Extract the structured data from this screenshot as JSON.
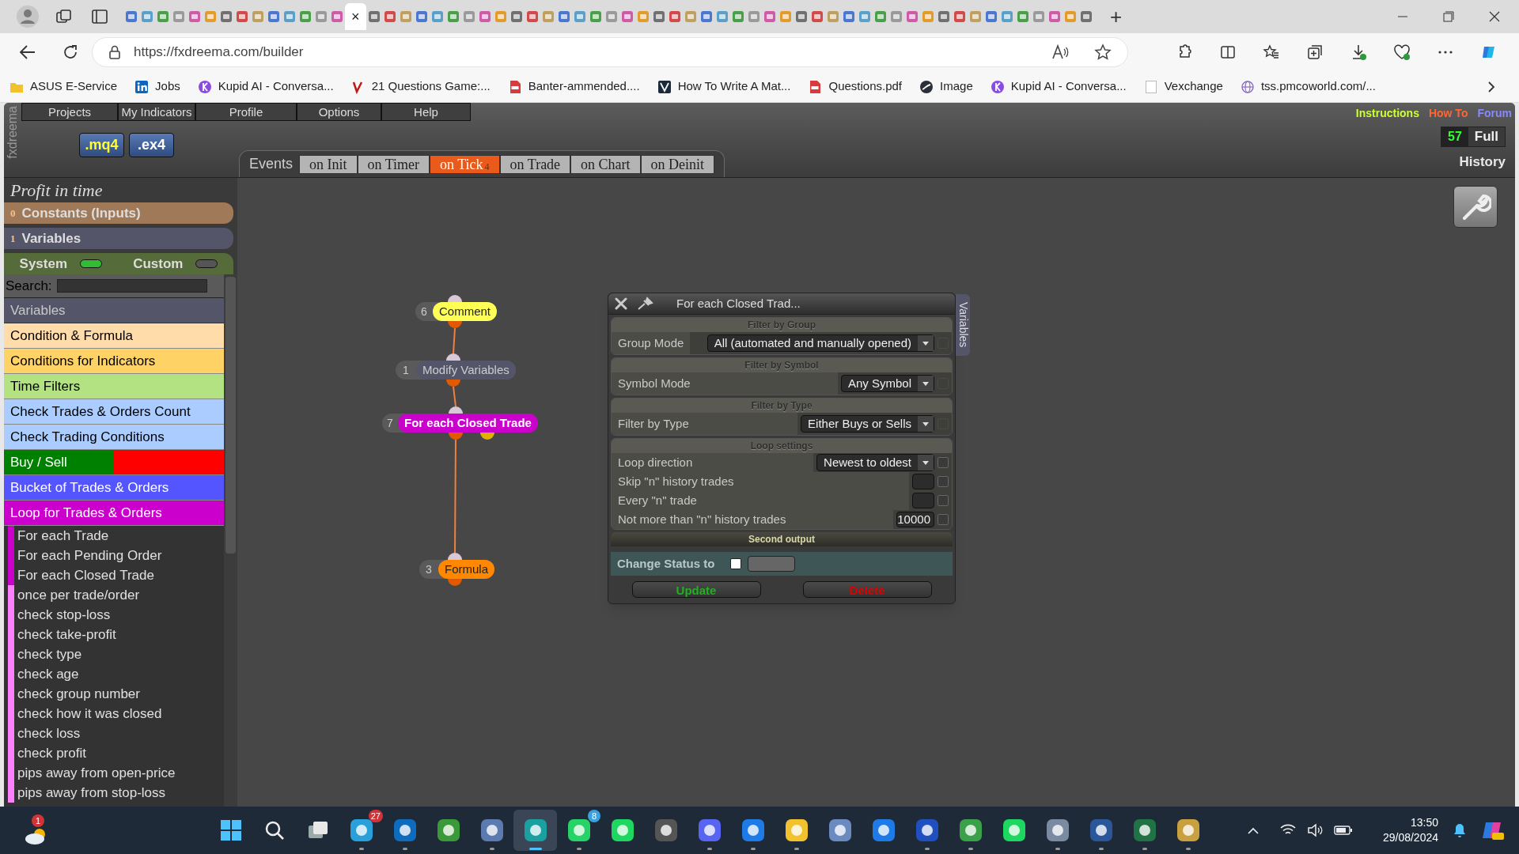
{
  "browser": {
    "tabs": [
      {
        "selected": false
      },
      {
        "selected": false
      },
      {
        "selected": false
      },
      {
        "selected": false
      },
      {
        "selected": false
      },
      {
        "selected": false
      },
      {
        "selected": false
      },
      {
        "selected": false
      },
      {
        "selected": false
      },
      {
        "selected": false
      },
      {
        "selected": false
      },
      {
        "selected": false
      },
      {
        "selected": false
      },
      {
        "selected": false
      },
      {
        "selected": true,
        "close": "×"
      },
      {
        "selected": false
      },
      {
        "selected": false
      },
      {
        "selected": false
      },
      {
        "selected": false
      },
      {
        "selected": false
      },
      {
        "selected": false
      },
      {
        "selected": false
      },
      {
        "selected": false
      },
      {
        "selected": false
      },
      {
        "selected": false
      },
      {
        "selected": false
      },
      {
        "selected": false
      },
      {
        "selected": false
      },
      {
        "selected": false
      },
      {
        "selected": false
      },
      {
        "selected": false
      },
      {
        "selected": false
      },
      {
        "selected": false
      },
      {
        "selected": false
      },
      {
        "selected": false
      },
      {
        "selected": false
      },
      {
        "selected": false
      },
      {
        "selected": false
      },
      {
        "selected": false
      },
      {
        "selected": false
      },
      {
        "selected": false
      },
      {
        "selected": false
      },
      {
        "selected": false
      },
      {
        "selected": false
      },
      {
        "selected": false
      },
      {
        "selected": false
      },
      {
        "selected": false
      },
      {
        "selected": false
      },
      {
        "selected": false
      },
      {
        "selected": false
      },
      {
        "selected": false
      },
      {
        "selected": false
      },
      {
        "selected": false
      },
      {
        "selected": false
      },
      {
        "selected": false
      },
      {
        "selected": false
      },
      {
        "selected": false
      },
      {
        "selected": false
      },
      {
        "selected": false
      },
      {
        "selected": false
      },
      {
        "selected": false
      }
    ],
    "new_tab": "+",
    "address": "https://fxdreema.com/builder",
    "bookmarks": [
      {
        "kind": "folder",
        "label": "ASUS E-Service"
      },
      {
        "kind": "linkedin",
        "label": "Jobs"
      },
      {
        "kind": "k",
        "label": "Kupid AI - Conversa..."
      },
      {
        "kind": "red",
        "label": "21 Questions Game:..."
      },
      {
        "kind": "pdf",
        "label": "Banter-ammended...."
      },
      {
        "kind": "dark",
        "label": "How To Write A Mat..."
      },
      {
        "kind": "pdf",
        "label": "Questions.pdf"
      },
      {
        "kind": "circle",
        "label": "Image"
      },
      {
        "kind": "k",
        "label": "Kupid AI - Conversa..."
      },
      {
        "kind": "blank",
        "label": "Vexchange"
      },
      {
        "kind": "globe",
        "label": "tss.pmcoworld.com/..."
      }
    ]
  },
  "app": {
    "logo": "fxdreema",
    "menu": [
      "Projects",
      "My Indicators",
      "Profile",
      "Options",
      "Help"
    ],
    "file_buttons": [
      ".mq4",
      ".ex4"
    ],
    "events_label": "Events",
    "event_tabs": [
      {
        "label": "on Init",
        "selected": false
      },
      {
        "label": "on Timer",
        "selected": false
      },
      {
        "label": "on Tick",
        "selected": true,
        "count": "4"
      },
      {
        "label": "on Trade",
        "selected": false
      },
      {
        "label": "on Chart",
        "selected": false
      },
      {
        "label": "on Deinit",
        "selected": false
      }
    ],
    "links": [
      {
        "label": "Instructions",
        "color": "#ccff33"
      },
      {
        "label": "How To",
        "color": "#ff6633"
      },
      {
        "label": "Forum",
        "color": "#8888ff"
      }
    ],
    "counter": "57",
    "full": "Full",
    "history": "History"
  },
  "sidebar": {
    "project": "Profit in time",
    "sections": [
      {
        "count": "0",
        "label": "Constants (Inputs)",
        "color": "#a07a58"
      },
      {
        "count": "1",
        "label": "Variables",
        "color": "#55556a"
      }
    ],
    "toggles": [
      {
        "label": "System",
        "on": true
      },
      {
        "label": "Custom",
        "on": false
      }
    ],
    "search_label": "Search:",
    "list_title": "Variables",
    "categories": [
      {
        "label": "Condition & Formula",
        "color": "#ffdcaa"
      },
      {
        "label": "Conditions for Indicators",
        "color": "#ffd266"
      },
      {
        "label": "Time Filters",
        "color": "#b2e282"
      },
      {
        "label": "Check Trades & Orders Count",
        "color": "#aaccff"
      },
      {
        "label": "Check Trading Conditions",
        "color": "#aaccff"
      },
      {
        "label": "Buy / Sell",
        "segments": [
          {
            "color": "#008000"
          },
          {
            "color": "#ff0000"
          }
        ]
      },
      {
        "label": "Bucket of Trades & Orders",
        "color": "#5555ff"
      },
      {
        "label": "Loop for Trades & Orders",
        "color": "#cc00cc",
        "expanded": true,
        "children": [
          {
            "label": "For each Trade",
            "color": "#cc00cc"
          },
          {
            "label": "For each Pending Order",
            "color": "#cc00cc"
          },
          {
            "label": "For each Closed Trade",
            "color": "#cc00cc"
          },
          {
            "label": "once per trade/order",
            "color": "#ff80ff"
          },
          {
            "label": "check stop-loss",
            "color": "#ff80ff"
          },
          {
            "label": "check take-profit",
            "color": "#ff80ff"
          },
          {
            "label": "check type",
            "color": "#ff80ff"
          },
          {
            "label": "check age",
            "color": "#ff80ff"
          },
          {
            "label": "check group number",
            "color": "#ff80ff"
          },
          {
            "label": "check how it was closed",
            "color": "#ff80ff"
          },
          {
            "label": "check loss",
            "color": "#ff80ff"
          },
          {
            "label": "check profit",
            "color": "#ff80ff"
          },
          {
            "label": "pips away from open-price",
            "color": "#ff80ff"
          },
          {
            "label": "pips away from stop-loss",
            "color": "#ff80ff"
          }
        ]
      }
    ]
  },
  "canvas": {
    "nodes": [
      {
        "number": "6",
        "label": "Comment",
        "color": "#ffff55"
      },
      {
        "number": "1",
        "label": "Modify Variables",
        "color": "#55556a"
      },
      {
        "number": "7",
        "label": "For each Closed Trade",
        "color": "#cc00cc"
      },
      {
        "number": "3",
        "label": "Formula",
        "color": "#ff8800"
      }
    ]
  },
  "dialog": {
    "title": "For each Closed Trad...",
    "side_tab": "Variables",
    "sections": [
      {
        "heading": "Filter by Group",
        "rows": [
          {
            "label": "Group Mode",
            "kind": "select",
            "value": "All (automated and manually opened)",
            "checked": false
          }
        ]
      },
      {
        "heading": "Filter by Symbol",
        "rows": [
          {
            "label": "Symbol Mode",
            "kind": "select",
            "value": "Any Symbol",
            "checked": false
          }
        ]
      },
      {
        "heading": "Filter by Type",
        "rows": [
          {
            "label": "Filter by Type",
            "kind": "select",
            "value": "Either Buys or Sells",
            "checked": false
          }
        ]
      },
      {
        "heading": "Loop settings",
        "rows": [
          {
            "label": "Loop direction",
            "kind": "select",
            "value": "Newest to oldest",
            "checked": false
          },
          {
            "label": "Skip \"n\" history trades",
            "kind": "input",
            "checked": false
          },
          {
            "label": "Every \"n\" trade",
            "kind": "input",
            "checked": false
          },
          {
            "label": "Not more than \"n\" history trades",
            "kind": "input",
            "value": "10000",
            "checked": false
          }
        ]
      }
    ],
    "second_output": "Second output",
    "change_status": {
      "label": "Change Status to",
      "checked": false
    },
    "buttons": [
      {
        "label": "Update",
        "kind": "confirm"
      },
      {
        "label": "Delete",
        "kind": "danger"
      }
    ]
  },
  "taskbar": {
    "weather_badge": "1",
    "apps": [
      {
        "kind": "start",
        "open": false,
        "selected": false
      },
      {
        "kind": "search",
        "open": false,
        "selected": false
      },
      {
        "kind": "taskview",
        "open": false,
        "selected": false
      },
      {
        "kind": "app",
        "color": "#2aa0da",
        "badge": "27",
        "open": true,
        "selected": false
      },
      {
        "kind": "app",
        "color": "#0f6cbd",
        "open": true,
        "selected": false
      },
      {
        "kind": "app",
        "color": "#3a9a3a",
        "open": false,
        "selected": false
      },
      {
        "kind": "app",
        "color": "#5a7ab0",
        "open": true,
        "selected": false
      },
      {
        "kind": "app",
        "color": "#1aa0a0",
        "open": true,
        "selected": true
      },
      {
        "kind": "app",
        "color": "#25d366",
        "badge": "8",
        "open": true,
        "selected": false
      },
      {
        "kind": "app",
        "color": "#1ed760",
        "open": false,
        "selected": false
      },
      {
        "kind": "app",
        "color": "#555555",
        "open": false,
        "selected": false
      },
      {
        "kind": "app",
        "color": "#5865f2",
        "open": true,
        "selected": false
      },
      {
        "kind": "app",
        "color": "#1e7ae6",
        "open": true,
        "selected": false
      },
      {
        "kind": "app",
        "color": "#f2c12e",
        "open": true,
        "selected": false
      },
      {
        "kind": "app",
        "color": "#6a8ac0",
        "open": false,
        "selected": false
      },
      {
        "kind": "app",
        "color": "#1e7ae6",
        "open": false,
        "selected": false
      },
      {
        "kind": "app",
        "color": "#2050c0",
        "open": true,
        "selected": false
      },
      {
        "kind": "app",
        "color": "#3aa04a",
        "open": true,
        "selected": false
      },
      {
        "kind": "app",
        "color": "#1ed760",
        "open": false,
        "selected": false
      },
      {
        "kind": "app",
        "color": "#7a8aa0",
        "open": true,
        "selected": false
      },
      {
        "kind": "app",
        "color": "#2b579a",
        "open": true,
        "selected": false
      },
      {
        "kind": "app",
        "color": "#217346",
        "open": true,
        "selected": false
      },
      {
        "kind": "app",
        "color": "#c8a040",
        "open": true,
        "selected": false
      }
    ],
    "time": "13:50",
    "date": "29/08/2024"
  }
}
